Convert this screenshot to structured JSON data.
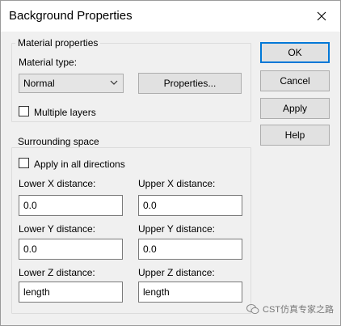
{
  "dialog": {
    "title": "Background Properties"
  },
  "material": {
    "group_label": "Material properties",
    "type_label": "Material type:",
    "type_value": "Normal",
    "properties_button": "Properties...",
    "multiple_layers_label": "Multiple layers",
    "multiple_layers_checked": false
  },
  "surrounding": {
    "group_label": "Surrounding space",
    "apply_all_label": "Apply in all directions",
    "apply_all_checked": false,
    "lower_x_label": "Lower X distance:",
    "lower_x_value": "0.0",
    "upper_x_label": "Upper X distance:",
    "upper_x_value": "0.0",
    "lower_y_label": "Lower Y distance:",
    "lower_y_value": "0.0",
    "upper_y_label": "Upper Y distance:",
    "upper_y_value": "0.0",
    "lower_z_label": "Lower Z distance:",
    "lower_z_value": "length",
    "upper_z_label": "Upper Z distance:",
    "upper_z_value": "length"
  },
  "buttons": {
    "ok": "OK",
    "cancel": "Cancel",
    "apply": "Apply",
    "help": "Help"
  },
  "watermark": {
    "text": "CST仿真专家之路"
  },
  "colors": {
    "accent": "#0078d7",
    "background": "#f0f0f0",
    "titlebar": "#ffffff"
  }
}
